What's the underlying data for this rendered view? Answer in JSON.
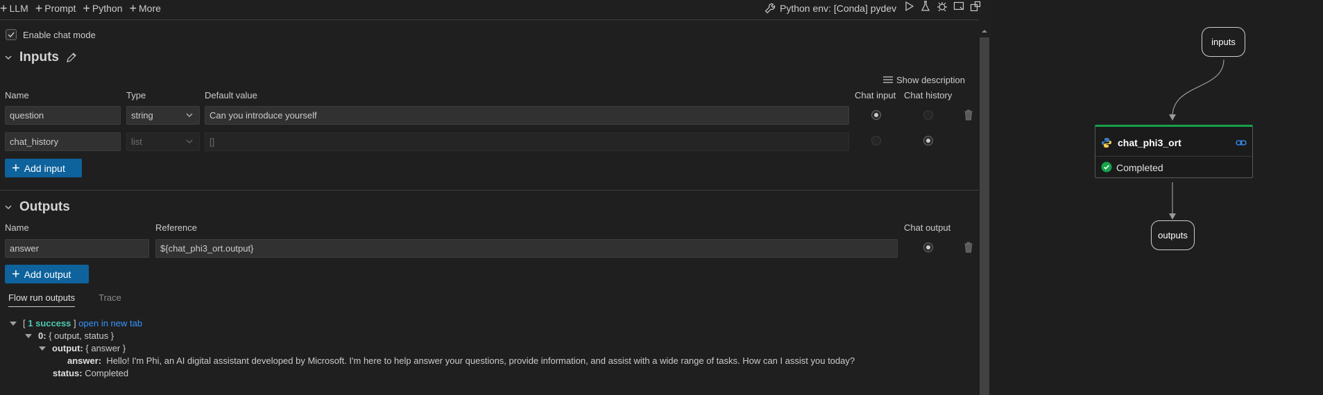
{
  "toolbar": {
    "items": [
      "LLM",
      "Prompt",
      "Python",
      "More"
    ],
    "python_env": "Python env: [Conda] pydev"
  },
  "chat_mode": {
    "label": "Enable chat mode",
    "checked": true
  },
  "inputs": {
    "title": "Inputs",
    "show_description": "Show description",
    "columns": {
      "name": "Name",
      "type": "Type",
      "default": "Default value",
      "chat_input": "Chat input",
      "chat_history": "Chat history"
    },
    "rows": [
      {
        "name": "question",
        "type": "string",
        "default": "Can you introduce yourself",
        "chat_input": true,
        "chat_history": false
      },
      {
        "name": "chat_history",
        "type": "list",
        "default": "[]",
        "chat_input": false,
        "chat_history": true
      }
    ],
    "add_label": "Add input"
  },
  "outputs": {
    "title": "Outputs",
    "columns": {
      "name": "Name",
      "reference": "Reference",
      "chat_output": "Chat output"
    },
    "rows": [
      {
        "name": "answer",
        "reference": "${chat_phi3_ort.output}",
        "chat_output": true
      }
    ],
    "add_label": "Add output"
  },
  "run_outputs": {
    "tabs": [
      "Flow run outputs",
      "Trace"
    ],
    "bracket_open": "[",
    "success": "1 success",
    "bracket_close": "]",
    "open_tab": "open in new tab",
    "item_key": "0:",
    "item_summary": "{ output, status }",
    "output_key": "output:",
    "output_summary": "{ answer }",
    "answer_key": "answer:",
    "answer_value": "Hello! I'm Phi, an AI digital assistant developed by Microsoft. I'm here to help answer your questions, provide information, and assist with a wide range of tasks. How can I assist you today?",
    "status_key": "status:",
    "status_value": "Completed"
  },
  "graph": {
    "inputs_label": "inputs",
    "node_name": "chat_phi3_ort",
    "node_status": "Completed",
    "outputs_label": "outputs",
    "accent_color": "#16a34a"
  }
}
